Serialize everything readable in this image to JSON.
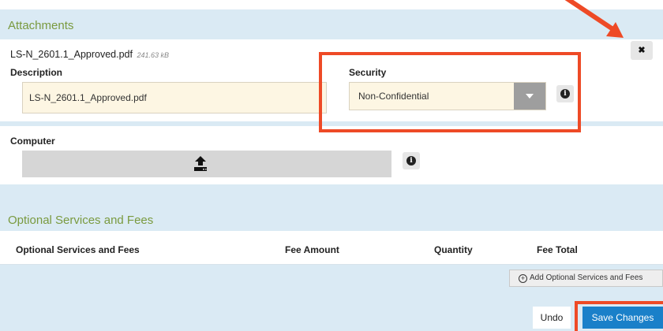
{
  "attachments": {
    "title": "Attachments",
    "file": {
      "name": "LS-N_2601.1_Approved.pdf",
      "size": "241.63 kB"
    },
    "description_label": "Description",
    "description_value": "LS-N_2601.1_Approved.pdf",
    "security_label": "Security",
    "security_value": "Non-Confidential",
    "computer_label": "Computer"
  },
  "optional": {
    "title": "Optional Services and Fees",
    "columns": [
      "Optional Services and Fees",
      "Fee Amount",
      "Quantity",
      "Fee Total"
    ],
    "add_label": "Add Optional Services and Fees"
  },
  "actions": {
    "undo_label": "Undo",
    "save_label": "Save Changes"
  },
  "icons": {
    "close": "close-icon",
    "info": "info-icon",
    "upload": "upload-icon",
    "dropdown": "chevron-down-icon",
    "add": "plus-circle-icon"
  },
  "colors": {
    "panel_bg": "#daeaf4",
    "section_title": "#7a9a3f",
    "input_bg": "#fdf6e3",
    "primary_button": "#1a80c9",
    "annotation": "#ee4a26"
  }
}
